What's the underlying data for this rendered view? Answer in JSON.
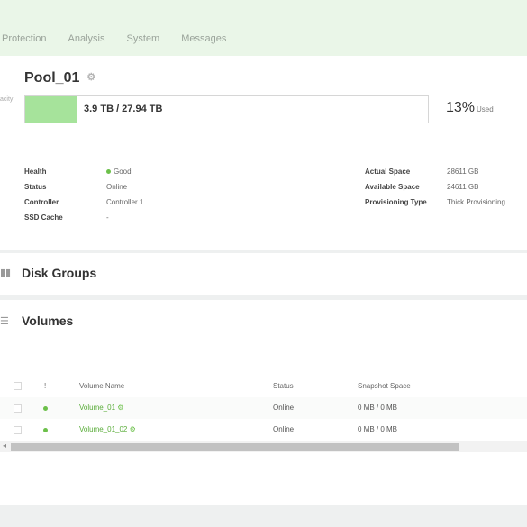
{
  "nav": {
    "items": [
      "Protection",
      "Analysis",
      "System",
      "Messages"
    ]
  },
  "pool": {
    "name": "Pool_01",
    "capacity_label": "acity",
    "capacity_text": "3.9 TB / 27.94 TB",
    "used_fraction": 0.13,
    "used_percent": "13%",
    "used_label": "Used"
  },
  "details_left": [
    {
      "label": "Health",
      "value": "Good"
    },
    {
      "label": "Status",
      "value": "Online"
    },
    {
      "label": "Controller",
      "value": "Controller 1"
    },
    {
      "label": "SSD Cache",
      "value": "-"
    }
  ],
  "details_right": [
    {
      "label": "Actual Space",
      "value": "28611 GB"
    },
    {
      "label": "Available Space",
      "value": "24611 GB"
    },
    {
      "label": "Provisioning Type",
      "value": "Thick Provisioning"
    }
  ],
  "disk_groups": {
    "title": "Disk Groups"
  },
  "volumes": {
    "title": "Volumes",
    "columns": [
      "!",
      "Volume Name",
      "Status",
      "Snapshot Space"
    ],
    "rows": [
      {
        "name": "Volume_01",
        "status": "Online",
        "snapshot": "0 MB / 0 MB"
      },
      {
        "name": "Volume_01_02",
        "status": "Online",
        "snapshot": "0 MB / 0 MB"
      }
    ]
  },
  "colors": {
    "accent": "#6cc04a",
    "capacity_fill": "#a6e39b",
    "link": "#5aad3a"
  },
  "icons": [
    "gear-icon",
    "disk-group-icon",
    "database-icon",
    "scroll-left-icon"
  ]
}
